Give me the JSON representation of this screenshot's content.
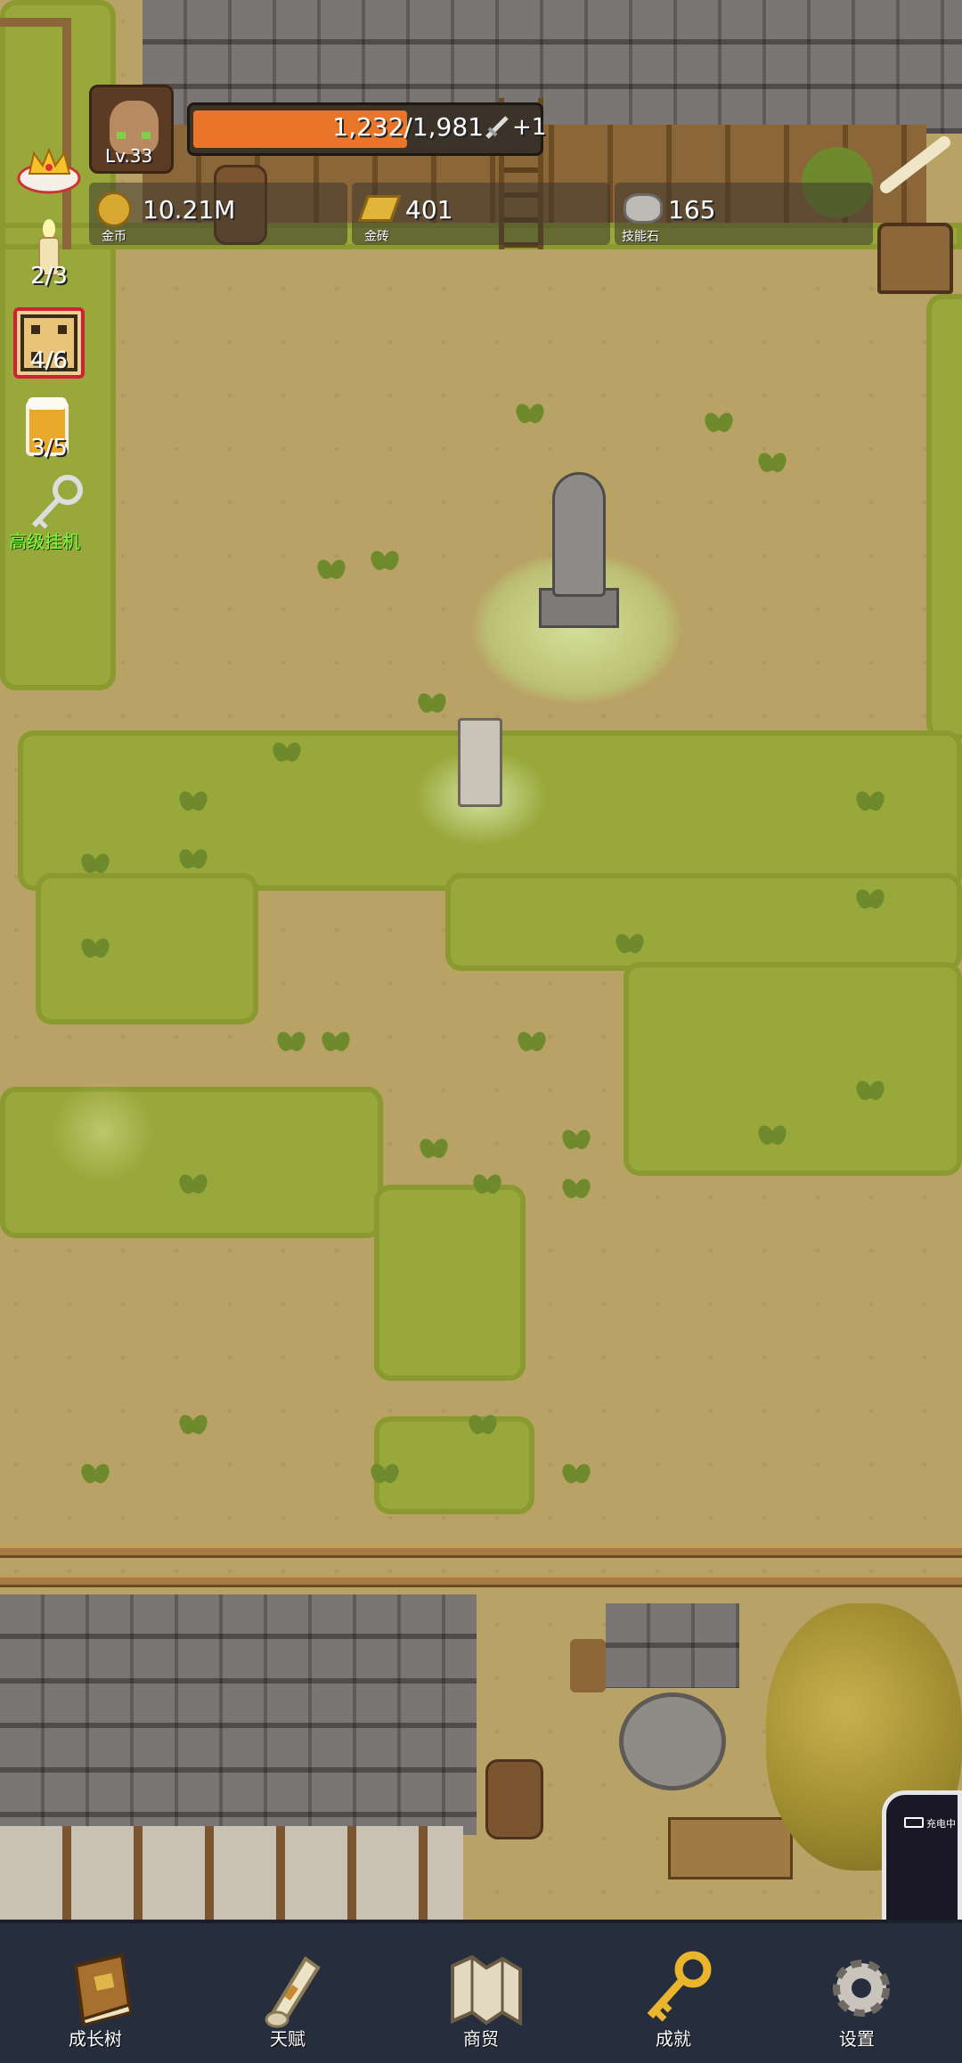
{
  "hud": {
    "level": "Lv.33",
    "exp_text": "1,232/1,981",
    "exp_progress": 0.622,
    "exp_bonus": "+1",
    "gold_value": "10.21M",
    "gold_label": "金币",
    "gold_brick_value": "401",
    "gold_brick_label": "金砖",
    "skill_stone_value": "165",
    "skill_stone_label": "技能石"
  },
  "side": {
    "candle_count": "2/3",
    "dice_count": "4/6",
    "beer_count": "3/5",
    "idle_label": "高级挂机"
  },
  "phone_overlay": {
    "status_text": "充电中"
  },
  "nav": {
    "items": [
      {
        "label": "成长树",
        "icon": "book-icon"
      },
      {
        "label": "天赋",
        "icon": "scroll-icon"
      },
      {
        "label": "商贸",
        "icon": "map-icon"
      },
      {
        "label": "成就",
        "icon": "key-icon"
      },
      {
        "label": "设置",
        "icon": "gear-icon"
      }
    ]
  },
  "colors": {
    "exp_bar": "#e8752a",
    "nav_bg": "#262d3d",
    "idle_label": "#7cff3a",
    "dirt": "#b9a265",
    "grass": "#98a83a"
  }
}
